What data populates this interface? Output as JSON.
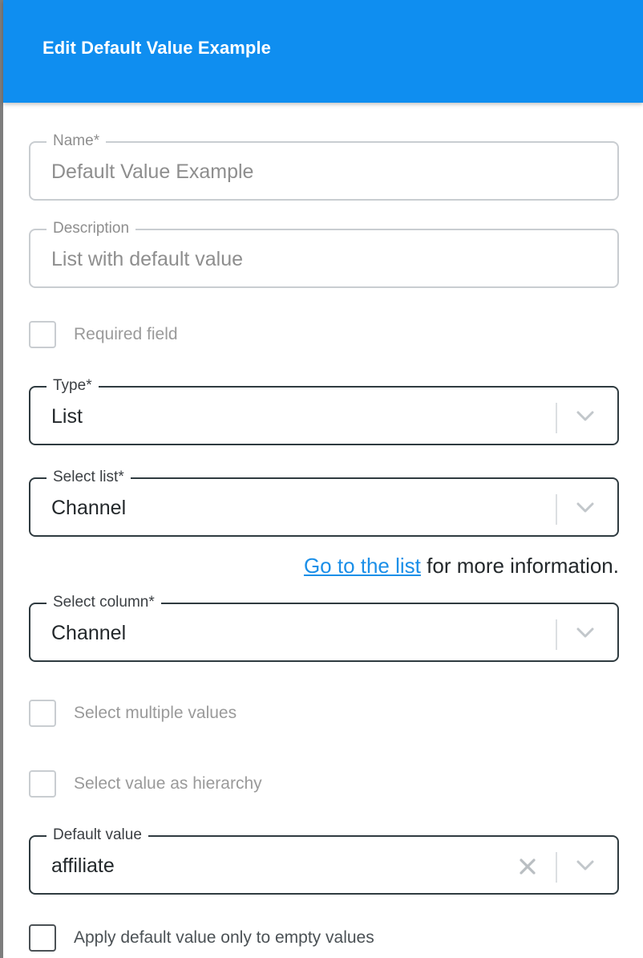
{
  "dialog": {
    "title": "Edit Default Value Example"
  },
  "fields": {
    "name": {
      "label": "Name",
      "required_mark": "*",
      "value": "Default Value Example"
    },
    "description": {
      "label": "Description",
      "value": "List with default value"
    },
    "type": {
      "label": "Type",
      "required_mark": "*",
      "value": "List"
    },
    "select_list": {
      "label": "Select list",
      "required_mark": "*",
      "value": "Channel"
    },
    "select_column": {
      "label": "Select column",
      "required_mark": "*",
      "value": "Channel"
    },
    "default_value": {
      "label": "Default value",
      "value": "affiliate"
    }
  },
  "checkboxes": {
    "required_field": {
      "label": "Required field",
      "checked": false
    },
    "select_multiple": {
      "label": "Select multiple values",
      "checked": false
    },
    "select_hierarchy": {
      "label": "Select value as hierarchy",
      "checked": false
    },
    "apply_default_empty": {
      "label": "Apply default value only to empty values",
      "checked": false
    }
  },
  "helper": {
    "link_text": "Go to the list",
    "suffix": " for more information."
  },
  "icons": {
    "dropdown": "chevron-down-icon",
    "clear": "close-icon"
  },
  "colors": {
    "header_bg": "#0f8ef0",
    "link": "#1b8fe8",
    "active_border": "#2f3b40",
    "disabled_border": "#c9cdd1"
  }
}
